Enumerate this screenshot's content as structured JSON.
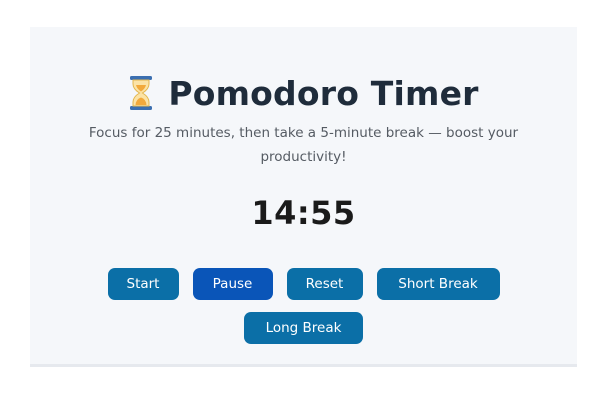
{
  "header": {
    "title": "Pomodoro Timer",
    "icon": "hourglass-icon"
  },
  "description": "Focus for 25 minutes, then take a 5-minute break — boost your productivity!",
  "timer": {
    "display": "14:55"
  },
  "controls": {
    "start_label": "Start",
    "pause_label": "Pause",
    "reset_label": "Reset",
    "short_break_label": "Short Break",
    "long_break_label": "Long Break"
  },
  "colors": {
    "button": "#0b6fa7",
    "button_active": "#0a55b8",
    "card_background": "#f5f7fa",
    "title": "#1f2c3b"
  }
}
